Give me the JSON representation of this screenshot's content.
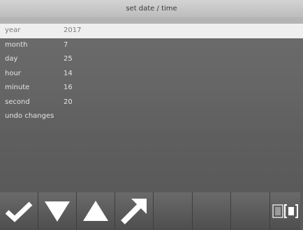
{
  "header": {
    "title": "set date / time"
  },
  "fields": [
    {
      "label": "year",
      "value": "2017",
      "selected": true
    },
    {
      "label": "month",
      "value": "7",
      "selected": false
    },
    {
      "label": "day",
      "value": "25",
      "selected": false
    },
    {
      "label": "hour",
      "value": "14",
      "selected": false
    },
    {
      "label": "minute",
      "value": "16",
      "selected": false
    },
    {
      "label": "second",
      "value": "20",
      "selected": false
    }
  ],
  "undo": {
    "label": "undo changes"
  },
  "toolbar": {
    "buttons": [
      {
        "icon": "checkmark-icon"
      },
      {
        "icon": "arrow-down-icon"
      },
      {
        "icon": "arrow-up-icon"
      },
      {
        "icon": "arrow-up-right-icon"
      },
      {
        "icon": ""
      },
      {
        "icon": ""
      },
      {
        "icon": ""
      },
      {
        "icon": "screen-toggle-icon"
      }
    ]
  },
  "colors": {
    "background": "#5c5c5c",
    "title_bar": "#c8c8c8",
    "selected_row": "#efefef",
    "text": "#e4e4e4",
    "icon": "#ffffff"
  }
}
